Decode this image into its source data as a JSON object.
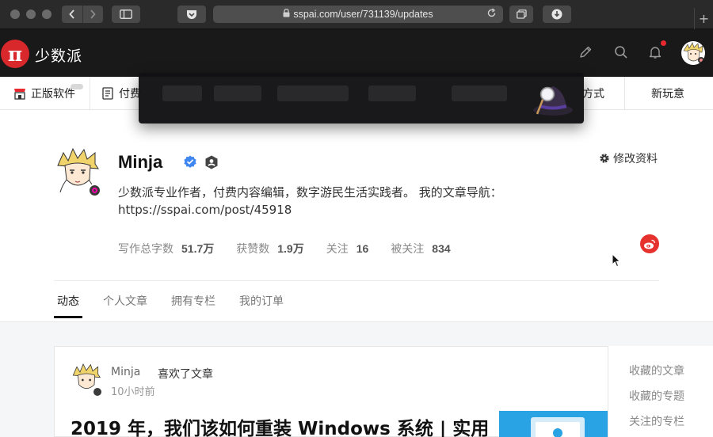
{
  "browser": {
    "url": "sspai.com/user/731139/updates",
    "back_icon": "chevron-left-icon",
    "forward_icon": "chevron-right-icon"
  },
  "header": {
    "logo_mark": "π",
    "logo_text": "少数派",
    "brand_color": "#d9282c"
  },
  "category_nav": {
    "items": [
      {
        "label": "正版软件",
        "icon": "store-icon"
      },
      {
        "label": "付费",
        "icon": "document-icon"
      },
      {
        "label": "方式"
      },
      {
        "label": "新玩意"
      }
    ]
  },
  "profile": {
    "name": "Minja",
    "edit_label": "修改资料",
    "bio": "少数派专业作者，付费内容编辑，数字游民生活实践者。 我的文章导航：https://sspai.com/post/45918",
    "stats": [
      {
        "label": "写作总字数",
        "value": "51.7万"
      },
      {
        "label": "获赞数",
        "value": "1.9万"
      },
      {
        "label": "关注",
        "value": "16"
      },
      {
        "label": "被关注",
        "value": "834"
      }
    ],
    "tabs": [
      "动态",
      "个人文章",
      "拥有专栏",
      "我的订单"
    ],
    "active_tab": "动态"
  },
  "feed": {
    "user": "Minja",
    "action": "喜欢了文章",
    "time": "10小时前",
    "title": "2019 年，我们该如何重装 Windows 系统 | 实用"
  },
  "sidebar": {
    "items": [
      "收藏的文章",
      "收藏的专题",
      "关注的专栏"
    ]
  }
}
